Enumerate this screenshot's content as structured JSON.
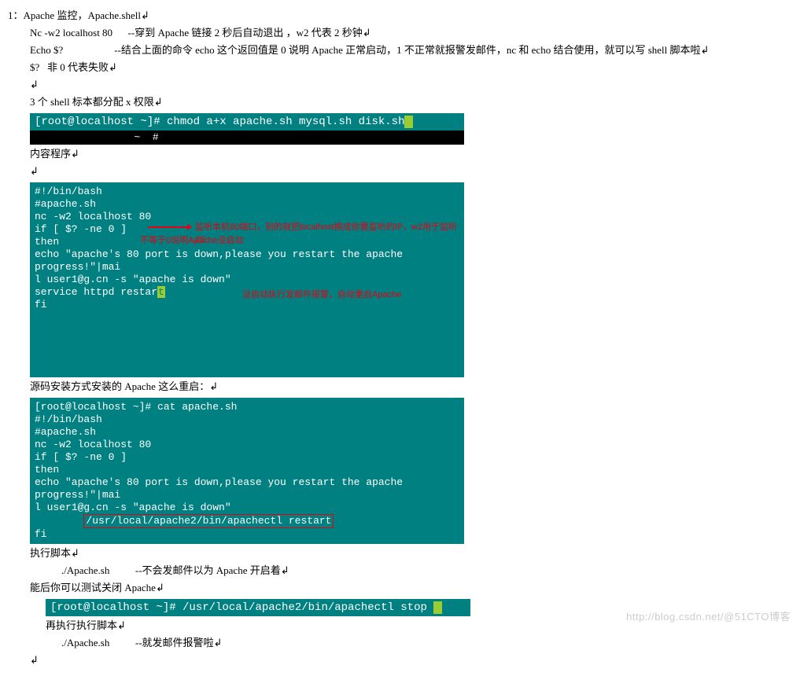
{
  "title_line": "1：Apache 监控，Apache.shell↲",
  "lines": {
    "l1": "Nc -w2 localhost 80      --穿到 Apache 链接 2 秒后自动退出 ，w2 代表 2 秒钟↲",
    "l2": "Echo $?                    --结合上面的命令 echo 这个返回值是 0 说明 Apache 正常启动，1 不正常就报警发邮件，nc 和 echo 结合使用，就可以写 shell 脚本啦↲",
    "l3": "$?   非 0 代表失败↲",
    "blank1": "↲",
    "l4": "3 个 shell 标本都分配 x 权限↲",
    "l5": "内容程序↲",
    "blank2": "↲",
    "l6": "源码安装方式安装的 Apache 这么重启：↲",
    "l7": "执行脚本↲",
    "l8": "./Apache.sh          --不会发邮件以为 Apache 开启着↲",
    "l9": "能后你可以测试关闭 Apache↲",
    "l10": "再执行执行脚本↲",
    "l11": "./Apache.sh          --就发邮件报警啦↲",
    "blank3": "↲"
  },
  "term_bar1": "[root@localhost ~]# chmod a+x apache.sh mysql.sh disk.sh ",
  "term_block1": {
    "t0": "#!/bin/bash",
    "t1": "#apache.sh",
    "t2": "",
    "t3": "nc -w2 localhost 80",
    "t4": "if [ $? -ne 0 ]",
    "t5": "then",
    "t6": "        echo \"apache's 80 port is down,please you restart the apache progress!\"|mai",
    "t7": "l user1@g.cn -s \"apache is down\"",
    "t8a": "        service httpd restar",
    "t8b": "t",
    "t9": "fi",
    "red1": "监听本机80端口，别的就把localhost换成你要监听的IP，w2用于监听2S",
    "red2": "不等于0说明Apache没启动",
    "red3": "没启动执行发邮件报警，自动重启Apache"
  },
  "term_block2": {
    "r0": "[root@localhost ~]# cat apache.sh",
    "r1": "#!/bin/bash",
    "r2": "#apache.sh",
    "r3": "",
    "r4": "nc -w2 localhost 80",
    "r5": "if [ $? -ne 0 ]",
    "r6": "then",
    "r7": "        echo \"apache's 80 port is down,please you restart the apache progress!\"|mai",
    "r8": "l user1@g.cn -s \"apache is down\"",
    "r9": "        /usr/local/apache2/bin/apachectl restart",
    "r10": "fi"
  },
  "term_bar2": "[root@localhost ~]# /usr/local/apache2/bin/apachectl stop ",
  "watermark": "http://blog.csdn.net/@51CTO博客"
}
